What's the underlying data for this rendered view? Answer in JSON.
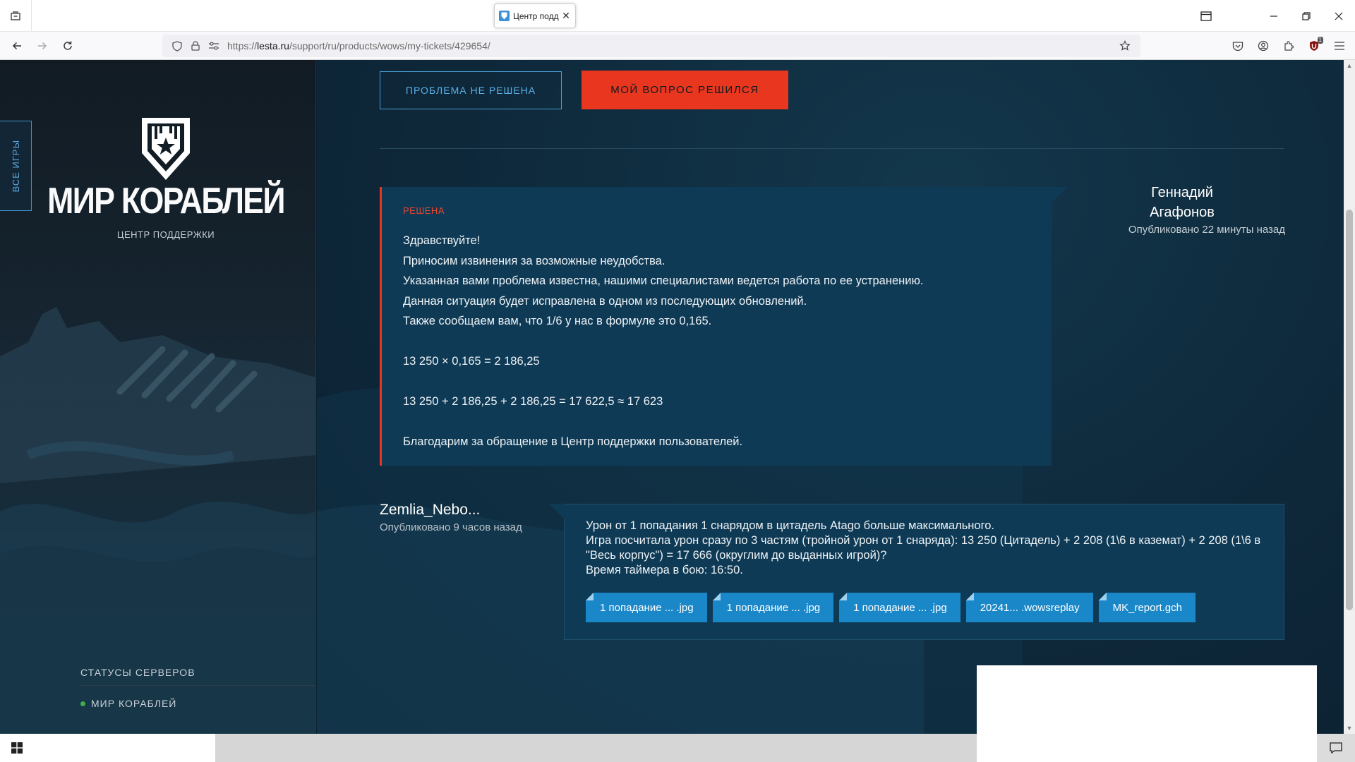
{
  "browser": {
    "tab_title": "Центр подд",
    "url_prefix": "https://",
    "url_host": "lesta.ru",
    "url_path": "/support/ru/products/wows/my-tickets/429654/",
    "extension_badge": "1"
  },
  "sidebar": {
    "all_games_label": "ВСЕ ИГРЫ",
    "logo_text": "МИР КОРАБЛЕЙ",
    "support_center_label": "ЦЕНТР ПОДДЕРЖКИ",
    "server_statuses_title": "СТАТУСЫ СЕРВЕРОВ",
    "servers": [
      {
        "name": "МИР КОРАБЛЕЙ",
        "status_color": "#3fae49"
      }
    ]
  },
  "actions": {
    "not_solved_label": "ПРОБЛЕМА НЕ РЕШЕНА",
    "solved_label": "МОЙ ВОПРОС РЕШИЛСЯ"
  },
  "agent_message": {
    "status": "РЕШЕНА",
    "lines": [
      "Здравствуйте!",
      "Приносим извинения за возможные неудобства.",
      "Указанная вами проблема известна, нашими специалистами ведется работа по ее устранению.",
      "Данная ситуация будет исправлена в одном из последующих обновлений.",
      "Также сообщаем вам, что 1/6 у нас в формуле это 0,165.",
      "",
      "13 250 × 0,165 = 2 186,25",
      "",
      "13 250 + 2 186,25 + 2 186,25 = 17 622,5 ≈ 17 623",
      "",
      "Благодарим за обращение в Центр поддержки пользователей."
    ],
    "author_first": "Геннадий",
    "author_last": "Агафонов",
    "published": "Опубликовано 22 минуты назад"
  },
  "user_message": {
    "author": "Zemlia_Nebo...",
    "published": "Опубликовано 9 часов назад",
    "lines": [
      "Урон от 1 попадания 1 снарядом в цитадель Atago больше максимального.",
      "Игра посчитала урон сразу по 3 частям (тройной урон от 1 снаряда): 13 250 (Цитадель) + 2 208 (1\\6 в каземат) + 2 208 (1\\6 в \"Весь корпус\") = 17 666 (округлим до выданных игрой)?",
      "Время таймера в бою: 16:50."
    ],
    "attachments": [
      "1 попадание ... .jpg",
      "1 попадание ... .jpg",
      "1 попадание ... .jpg",
      "20241... .wowsreplay",
      "MK_report.gch"
    ]
  },
  "colors": {
    "accent_red": "#e8361f",
    "accent_blue": "#1a87c9",
    "panel": "#0f3a55"
  }
}
